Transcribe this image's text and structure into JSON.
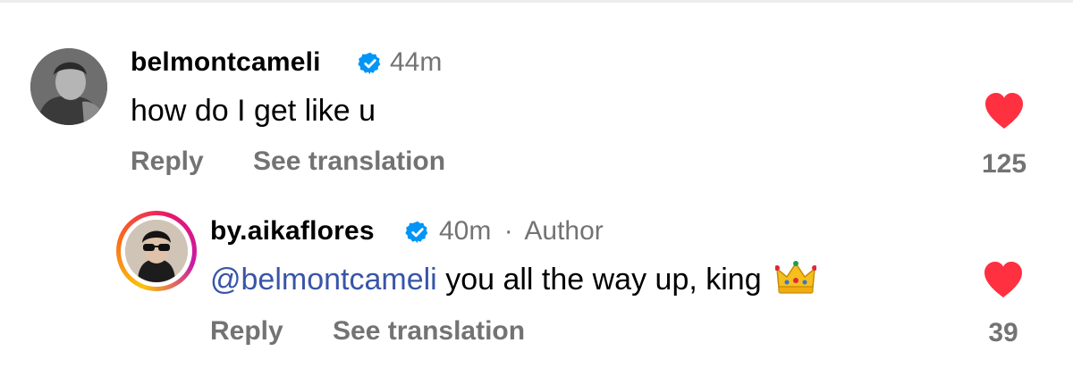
{
  "comments": [
    {
      "username": "belmontcameli",
      "verified": true,
      "time": "44m",
      "text": "how do I get like u",
      "actions": {
        "reply": "Reply",
        "translate": "See translation"
      },
      "likes": "125",
      "liked": true,
      "avatar_icon": "user-avatar-photo"
    }
  ],
  "reply": {
    "username": "by.aikaflores",
    "verified": true,
    "time": "40m",
    "separator": "·",
    "badge": "Author",
    "mention": "@belmontcameli",
    "text": "you all the way up, king",
    "emoji_icon": "crown-emoji",
    "actions": {
      "reply": "Reply",
      "translate": "See translation"
    },
    "likes": "39",
    "liked": true,
    "avatar_icon": "story-ring-avatar"
  },
  "colors": {
    "like_red": "#ff3040",
    "verified_blue": "#0095f6",
    "secondary_text": "#737373",
    "mention_blue": "#3955a8"
  }
}
